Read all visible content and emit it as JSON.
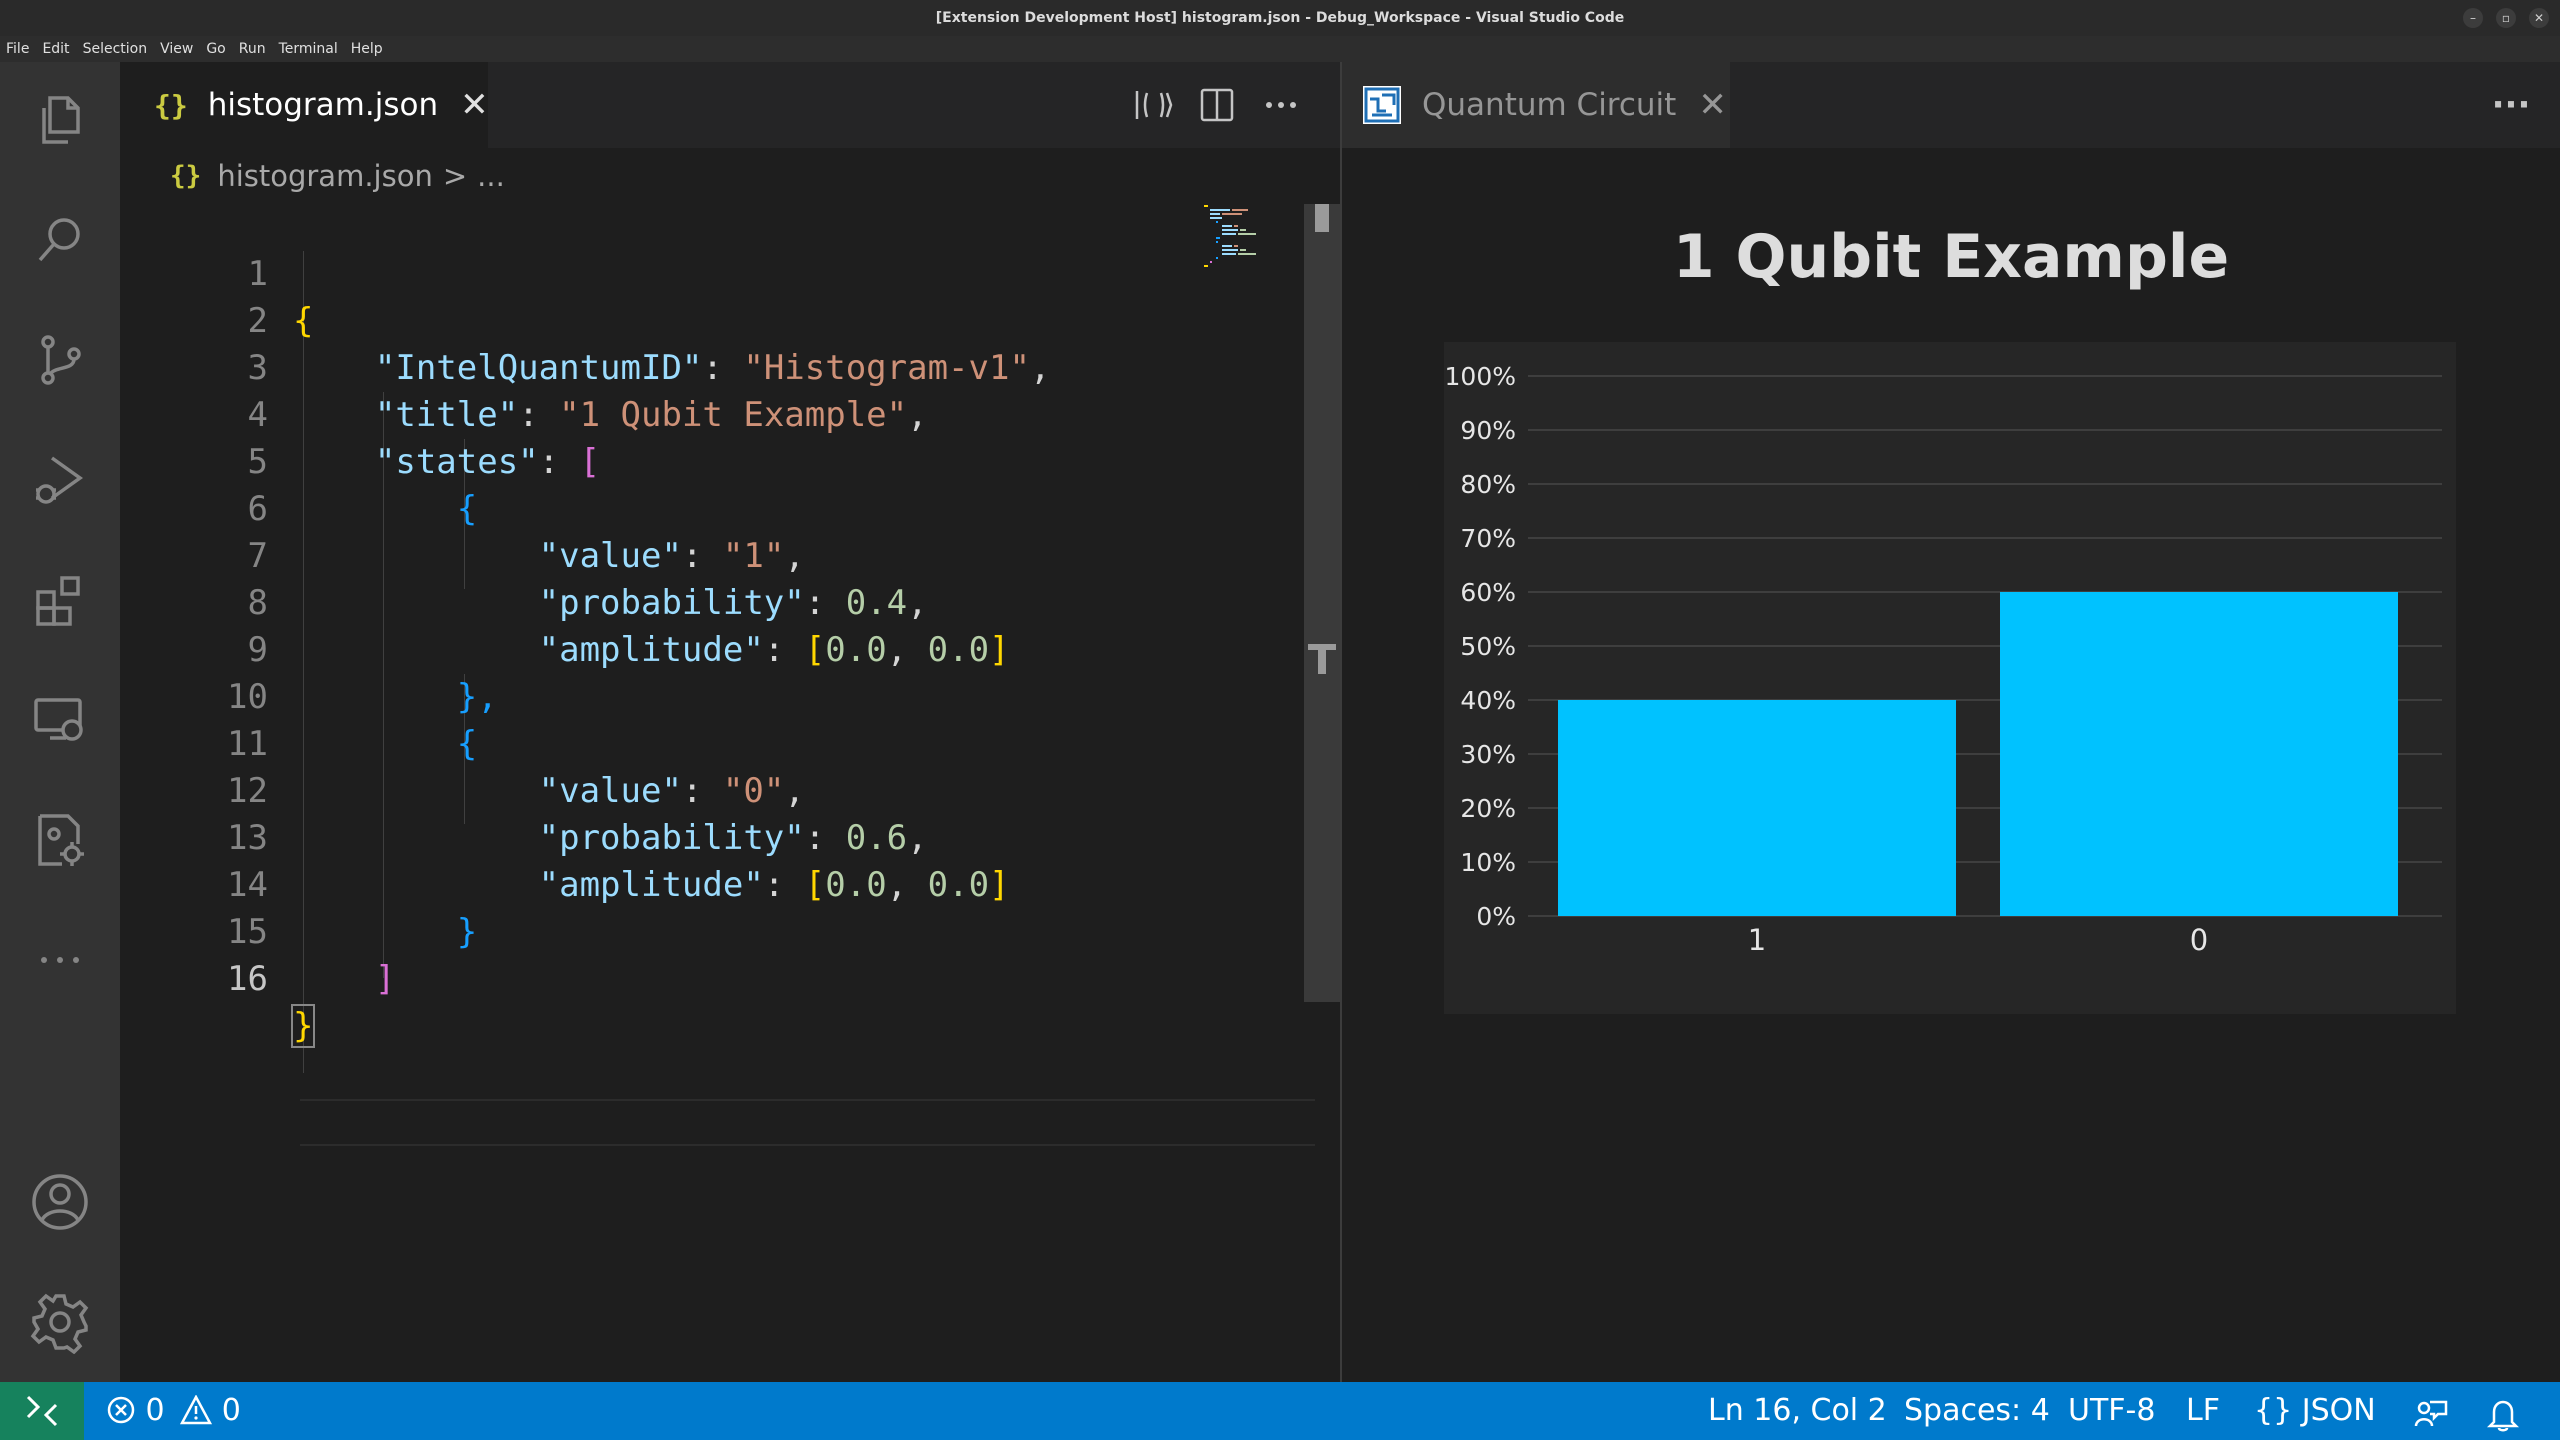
{
  "window": {
    "title": "[Extension Development Host] histogram.json - Debug_Workspace - Visual Studio Code",
    "controls": {
      "minimize": "–",
      "restore": "▫",
      "close": "✕"
    }
  },
  "menu": [
    "File",
    "Edit",
    "Selection",
    "View",
    "Go",
    "Run",
    "Terminal",
    "Help"
  ],
  "activity_bar": [
    "explorer-icon",
    "search-icon",
    "source-control-icon",
    "run-debug-icon",
    "extensions-icon",
    "remote-explorer-icon",
    "quantum-extension-icon",
    "more-icon",
    "account-icon",
    "settings-gear-icon"
  ],
  "editor": {
    "tab": {
      "icon": "{}",
      "label": "histogram.json",
      "close": "✕"
    },
    "breadcrumb": {
      "icon": "{}",
      "file": "histogram.json",
      "separator": ">",
      "rest": "..."
    },
    "cursor_line": 16,
    "lines": [
      {
        "n": "1"
      },
      {
        "n": "2"
      },
      {
        "n": "3"
      },
      {
        "n": "4"
      },
      {
        "n": "5"
      },
      {
        "n": "6"
      },
      {
        "n": "7"
      },
      {
        "n": "8"
      },
      {
        "n": "9"
      },
      {
        "n": "10"
      },
      {
        "n": "11"
      },
      {
        "n": "12"
      },
      {
        "n": "13"
      },
      {
        "n": "14"
      },
      {
        "n": "15"
      },
      {
        "n": "16"
      }
    ],
    "tokens": {
      "brace_open": "{",
      "brace_close": "}",
      "brace_close_comma": "},",
      "bracket_open": "[",
      "bracket_close": "]",
      "colon": ": ",
      "comma": ",",
      "key_id": "\"IntelQuantumID\"",
      "val_id": "\"Histogram-v1\"",
      "key_title": "\"title\"",
      "val_title": "\"1 Qubit Example\"",
      "key_states": "\"states\"",
      "key_value": "\"value\"",
      "val_1": "\"1\"",
      "val_0": "\"0\"",
      "key_prob": "\"probability\"",
      "prob_1": "0.4",
      "prob_0": "0.6",
      "key_amp": "\"amplitude\"",
      "amp_open": "[",
      "amp_num": "0.0",
      "amp_sep": ", ",
      "amp_close": "]"
    }
  },
  "preview": {
    "tab": {
      "label": "Quantum Circuit",
      "close": "✕"
    },
    "more": "···"
  },
  "chart_data": {
    "type": "bar",
    "title": "1 Qubit Example",
    "categories": [
      "1",
      "0"
    ],
    "values": [
      0.4,
      0.6
    ],
    "ylim": [
      0,
      1
    ],
    "yticks": [
      "0%",
      "10%",
      "20%",
      "30%",
      "40%",
      "50%",
      "60%",
      "70%",
      "80%",
      "90%",
      "100%"
    ],
    "grid": true,
    "bar_color": "#00c2ff"
  },
  "status_bar": {
    "errors": "0",
    "warnings": "0",
    "position": "Ln 16, Col 2",
    "spaces": "Spaces: 4",
    "encoding": "UTF-8",
    "eol": "LF",
    "language_icon": "{}",
    "language": "JSON",
    "color": "#007acc",
    "remote_color": "#16825d"
  }
}
